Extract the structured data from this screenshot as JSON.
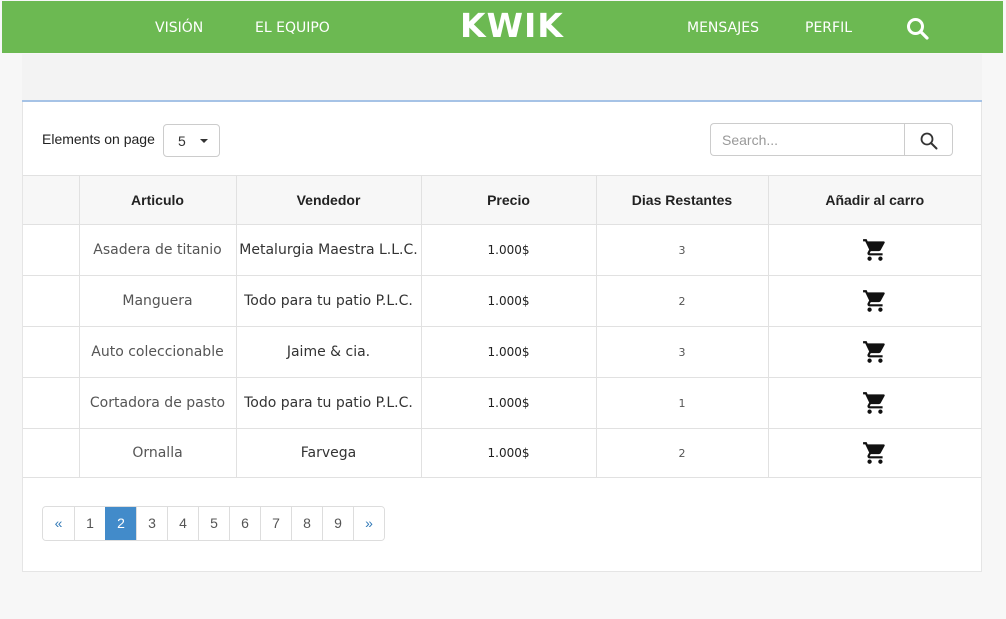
{
  "navbar": {
    "brand": "KWIK",
    "links_left": [
      "VISIÓN",
      "EL EQUIPO"
    ],
    "links_right": [
      "MENSAJES",
      "PERFIL"
    ],
    "search_icon": "search-icon",
    "bg_color": "#6cb952"
  },
  "controls": {
    "elements_label": "Elements on page",
    "elements_value": "5",
    "search_placeholder": "Search...",
    "search_icon": "search-icon"
  },
  "table": {
    "headers": [
      "",
      "Articulo",
      "Vendedor",
      "Precio",
      "Dias Restantes",
      "Añadir al carro"
    ],
    "rows": [
      {
        "articulo": "Asadera de titanio",
        "vendedor": "Metalurgia Maestra L.L.C.",
        "precio": "1.000$",
        "dias": "3"
      },
      {
        "articulo": "Manguera",
        "vendedor": "Todo para tu patio P.L.C.",
        "precio": "1.000$",
        "dias": "2"
      },
      {
        "articulo": "Auto coleccionable",
        "vendedor": "Jaime & cia.",
        "precio": "1.000$",
        "dias": "3"
      },
      {
        "articulo": "Cortadora de pasto",
        "vendedor": "Todo para tu patio P.L.C.",
        "precio": "1.000$",
        "dias": "1"
      },
      {
        "articulo": "Ornalla",
        "vendedor": "Farvega",
        "precio": "1.000$",
        "dias": "2"
      }
    ],
    "cart_icon": "cart-icon"
  },
  "pagination": {
    "prev": "«",
    "pages": [
      "1",
      "2",
      "3",
      "4",
      "5",
      "6",
      "7",
      "8",
      "9"
    ],
    "active": "2",
    "next": "»",
    "active_color": "#428bca"
  }
}
